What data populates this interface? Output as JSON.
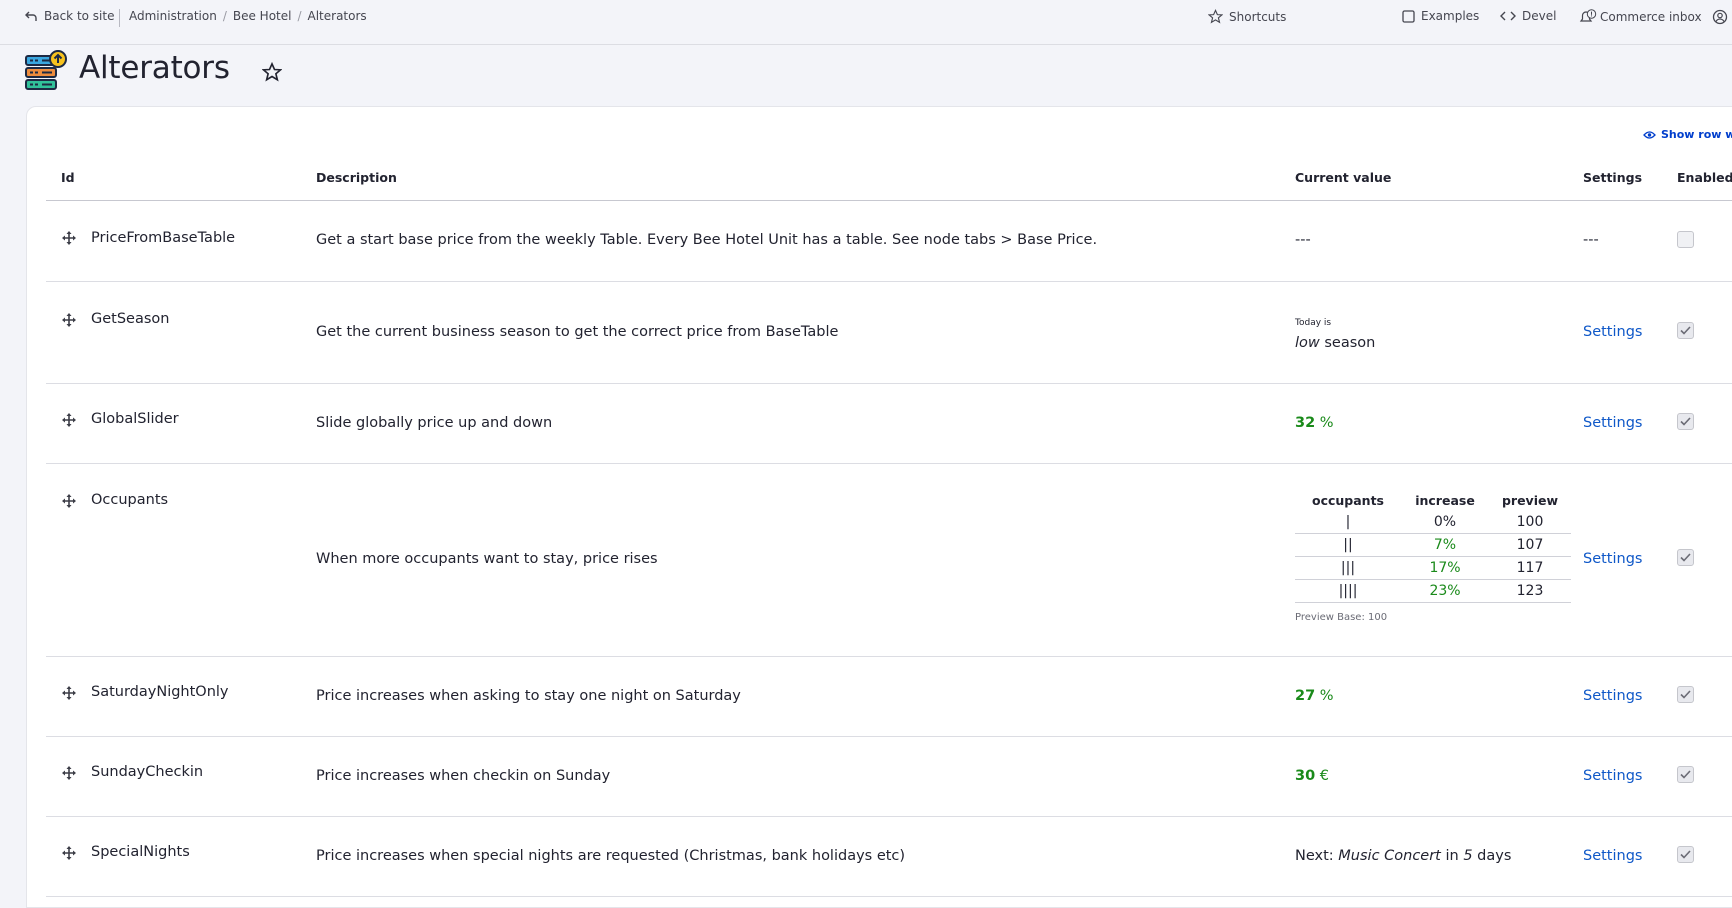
{
  "toolbar": {
    "back_to_site": "Back to site",
    "breadcrumb": [
      "Administration",
      "Bee Hotel",
      "Alterators"
    ],
    "shortcuts": "Shortcuts",
    "examples": "Examples",
    "devel": "Devel",
    "commerce_inbox": "Commerce inbox",
    "icons": {
      "back": "back-arrow-icon",
      "shortcuts": "star-icon",
      "examples": "square-icon",
      "devel": "code-icon",
      "inbox": "bell-icon",
      "user": "user-icon"
    }
  },
  "page": {
    "title": "Alterators",
    "show_row_weights": "Show row weig"
  },
  "table": {
    "headers": {
      "id": "Id",
      "description": "Description",
      "current_value": "Current value",
      "settings": "Settings",
      "enabled": "Enabled"
    },
    "settings_label": "Settings",
    "rows": [
      {
        "id": "PriceFromBaseTable",
        "description": "Get a start base price from the weekly Table. Every Bee Hotel Unit has a table. See node tabs > Base Price.",
        "current": "---",
        "settings": "---",
        "enabled": false
      },
      {
        "id": "GetSeason",
        "description": "Get the current business season to get the correct price from BaseTable",
        "current_small": "Today is",
        "current_season": "low",
        "current_suffix": "season",
        "enabled": true
      },
      {
        "id": "GlobalSlider",
        "description": "Slide globally price up and down",
        "current_value": "32",
        "current_unit": "%",
        "enabled": true
      },
      {
        "id": "Occupants",
        "description": "When more occupants want to stay, price rises",
        "occupants_table": {
          "headers": [
            "occupants",
            "increase",
            "preview"
          ],
          "rows": [
            {
              "occupants": "|",
              "increase": "0%",
              "preview": "100"
            },
            {
              "occupants": "||",
              "increase": "7%",
              "preview": "107"
            },
            {
              "occupants": "|||",
              "increase": "17%",
              "preview": "117"
            },
            {
              "occupants": "||||",
              "increase": "23%",
              "preview": "123"
            }
          ],
          "note": "Preview Base: 100"
        },
        "enabled": true
      },
      {
        "id": "SaturdayNightOnly",
        "description": "Price increases when asking to stay one night on Saturday",
        "current_value": "27",
        "current_unit": "%",
        "enabled": true
      },
      {
        "id": "SundayCheckin",
        "description": "Price increases when checkin on Sunday",
        "current_value": "30",
        "current_unit": "€",
        "enabled": true
      },
      {
        "id": "SpecialNights",
        "description": "Price increases when special nights are requested (Christmas, bank holidays etc)",
        "next_label": "Next:",
        "next_event": "Music Concert",
        "next_in": "in",
        "next_days": "5",
        "next_days_label": "days",
        "enabled": true
      }
    ]
  },
  "colors": {
    "link": "#0f58c8",
    "positive": "#1a8a1a",
    "background": "#f3f4f9"
  }
}
